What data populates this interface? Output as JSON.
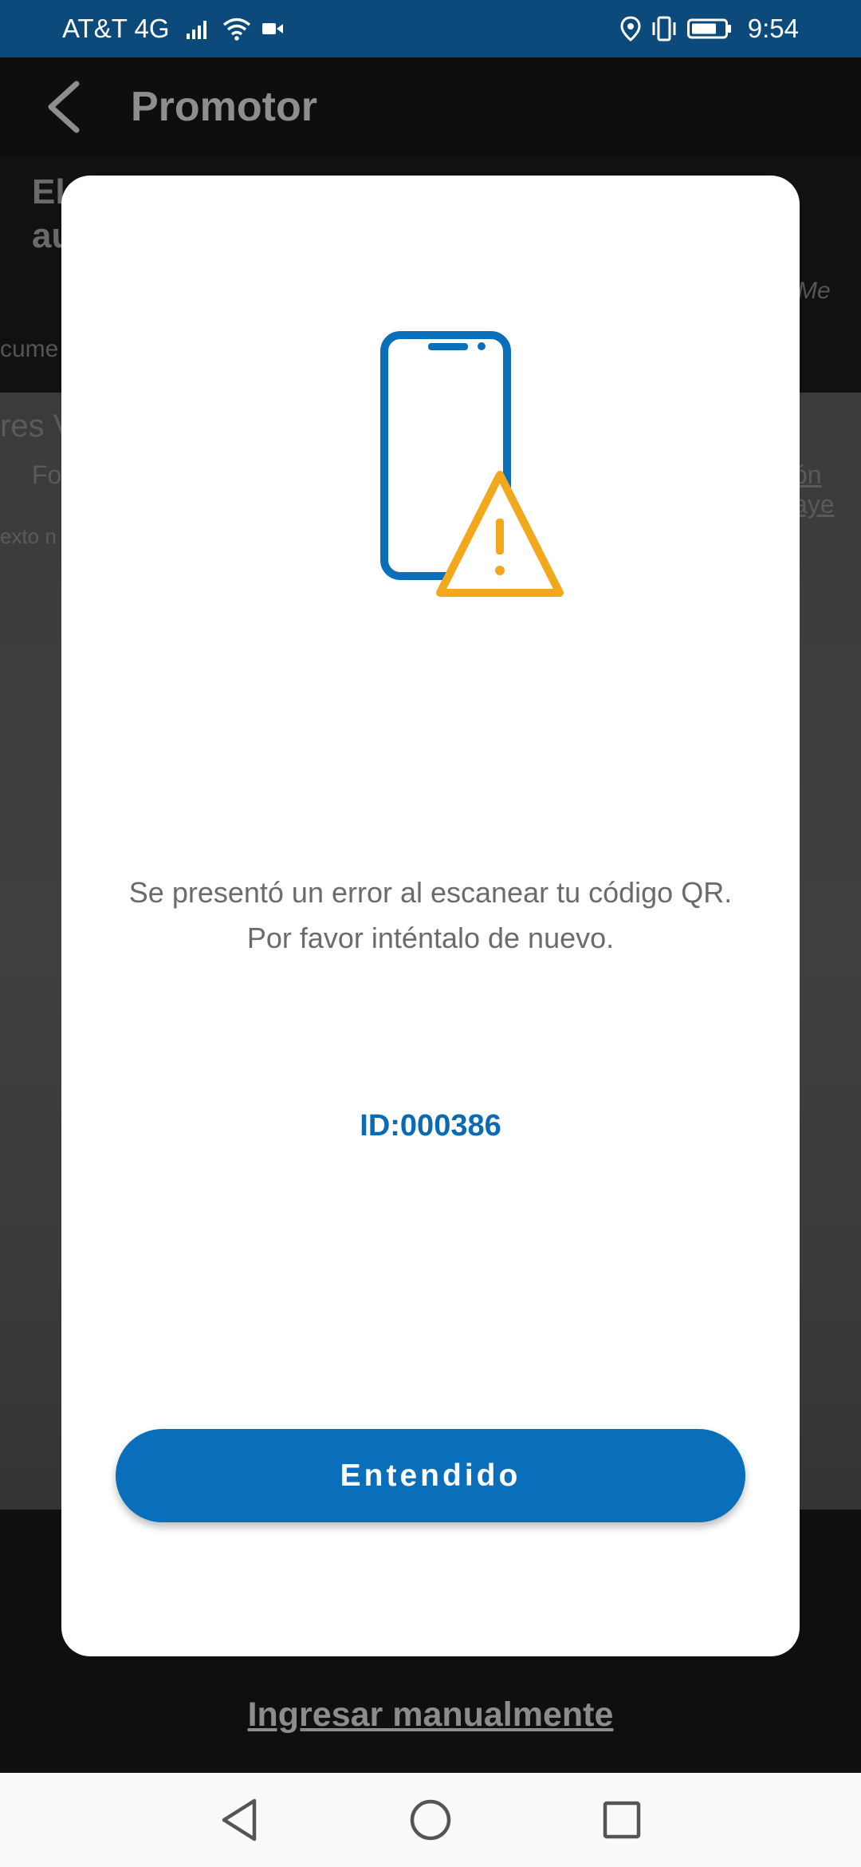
{
  "status_bar": {
    "carrier": "AT&T 4G",
    "time": "9:54",
    "icons": [
      "signal-icon",
      "wifi-icon",
      "video-icon",
      "location-icon",
      "vibrate-icon",
      "battery-icon"
    ]
  },
  "app_bar": {
    "title": "Promotor",
    "back_icon": "back-arrow-icon"
  },
  "background_fragments": {
    "line1": "El",
    "line2": "au",
    "line3": "cume",
    "line4": "res V",
    "line5": "Fo",
    "line6": "exto n",
    "right1": "Me",
    "right2": "ón aye"
  },
  "modal": {
    "illustration": "phone-warning-icon",
    "message": "Se presentó un error al escanear tu código QR.  Por favor inténtalo de nuevo.",
    "id_text": "ID:000386",
    "button_label": "Entendido"
  },
  "manual_link": "Ingresar manualmente",
  "nav_bar": {
    "icons": [
      "back-triangle-icon",
      "home-circle-icon",
      "recents-square-icon"
    ]
  },
  "colors": {
    "primary": "#0A6FBA",
    "warning": "#F2A81D",
    "status_bar": "#0B4A7A"
  }
}
